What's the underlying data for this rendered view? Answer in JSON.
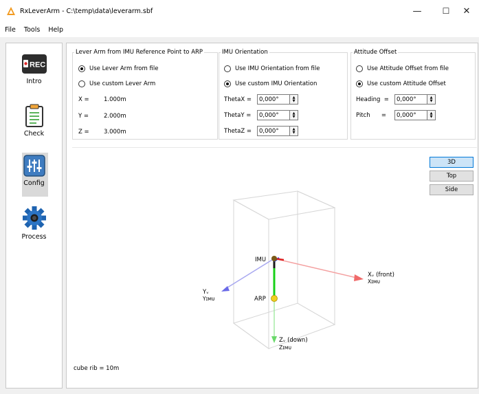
{
  "window": {
    "title": "RxLeverArm - C:\\temp\\data\\leverarm.sbf",
    "minimize": "—",
    "maximize": "☐",
    "close": "✕"
  },
  "menu": [
    "File",
    "Tools",
    "Help"
  ],
  "sidebar": {
    "items": [
      {
        "label": "Intro",
        "icon_text": "REC"
      },
      {
        "label": "Check"
      },
      {
        "label": "Config"
      },
      {
        "label": "Process"
      }
    ],
    "selected": "Config"
  },
  "lever_arm": {
    "legend": "Lever Arm from IMU Reference Point to ARP",
    "opt_file": "Use Lever Arm from file",
    "opt_custom": "Use custom Lever Arm",
    "selected": "file",
    "x_label": "X  =",
    "x_value": "1.000m",
    "y_label": "Y  =",
    "y_value": "2.000m",
    "z_label": "Z  =",
    "z_value": "3.000m"
  },
  "imu_orientation": {
    "legend": "IMU Orientation",
    "opt_file": "Use IMU Orientation from file",
    "opt_custom": "Use custom IMU Orientation",
    "selected": "custom",
    "thetax_label": "ThetaX  =",
    "thetax_value": "0,000°",
    "thetay_label": "ThetaY  =",
    "thetay_value": "0,000°",
    "thetaz_label": "ThetaZ  =",
    "thetaz_value": "0,000°"
  },
  "attitude_offset": {
    "legend": "Attitude Offset",
    "opt_file": "Use Attitude Offset from file",
    "opt_custom": "Use custom Attitude Offset",
    "selected": "custom",
    "heading_label": "Heading  =",
    "heading_value": "0,000°",
    "pitch_label": "Pitch      =",
    "pitch_value": "0,000°"
  },
  "view": {
    "buttons": [
      "3D",
      "Top",
      "Side"
    ],
    "active": "3D",
    "labels": {
      "imu": "IMU",
      "arp": "ARP",
      "xv": "Xᵥ (front)",
      "ximu": "Xɪᴍᴜ",
      "yv": "Yᵥ",
      "yimu": "Yɪᴍᴜ",
      "zv": "Zᵥ (down)",
      "zimu": "Zɪᴍᴜ"
    },
    "cube_note": "cube rib = 10m"
  }
}
